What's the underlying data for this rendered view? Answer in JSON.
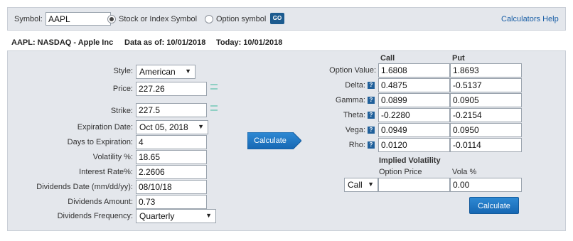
{
  "symbol_bar": {
    "label": "Symbol:",
    "value": "AAPL",
    "stock_option_label": "Stock or Index Symbol",
    "option_symbol_label": "Option symbol",
    "go_label": "GO",
    "help_link": "Calculators Help"
  },
  "info": {
    "quote": "AAPL: NASDAQ - Apple Inc",
    "data_as_of": "Data as of: 10/01/2018",
    "today": "Today: 10/01/2018"
  },
  "inputs": {
    "style_label": "Style:",
    "style_value": "American",
    "price_label": "Price:",
    "price_value": "227.26",
    "strike_label": "Strike:",
    "strike_value": "227.5",
    "expiration_label": "Expiration Date:",
    "expiration_value": "Oct 05, 2018",
    "days_label": "Days to Expiration:",
    "days_value": "4",
    "volatility_label": "Volatility %:",
    "volatility_value": "18.65",
    "interest_label": "Interest Rate%:",
    "interest_value": "2.2606",
    "div_date_label": "Dividends Date (mm/dd/yy):",
    "div_date_value": "08/10/18",
    "div_amount_label": "Dividends Amount:",
    "div_amount_value": "0.73",
    "div_freq_label": "Dividends Frequency:",
    "div_freq_value": "Quarterly"
  },
  "calculate_label": "Calculate",
  "results": {
    "call_header": "Call",
    "put_header": "Put",
    "rows": [
      {
        "label": "Option Value:",
        "call": "1.6808",
        "put": "1.8693",
        "help": false
      },
      {
        "label": "Delta:",
        "call": "0.4875",
        "put": "-0.5137",
        "help": true
      },
      {
        "label": "Gamma:",
        "call": "0.0899",
        "put": "0.0905",
        "help": true
      },
      {
        "label": "Theta:",
        "call": "-0.2280",
        "put": "-0.2154",
        "help": true
      },
      {
        "label": "Vega:",
        "call": "0.0949",
        "put": "0.0950",
        "help": true
      },
      {
        "label": "Rho:",
        "call": "0.0120",
        "put": "-0.0114",
        "help": true
      }
    ],
    "help_icon_glyph": "?"
  },
  "implied": {
    "title": "Implied Volatility",
    "option_price_header": "Option Price",
    "vola_header": "Vola %",
    "type_value": "Call",
    "option_price_value": "",
    "vola_value": "0.00",
    "calculate_label": "Calculate"
  },
  "icons": {
    "radio_selected": "radio-selected-icon",
    "radio_unselected": "radio-unselected-icon",
    "dropdown": "chevron-down-icon",
    "help": "question-icon"
  },
  "colors": {
    "panel_bg": "#e4e7ec",
    "accent_blue": "#1667b3",
    "link_blue": "#1a5fa6",
    "help_icon": "#1f5f9a"
  }
}
